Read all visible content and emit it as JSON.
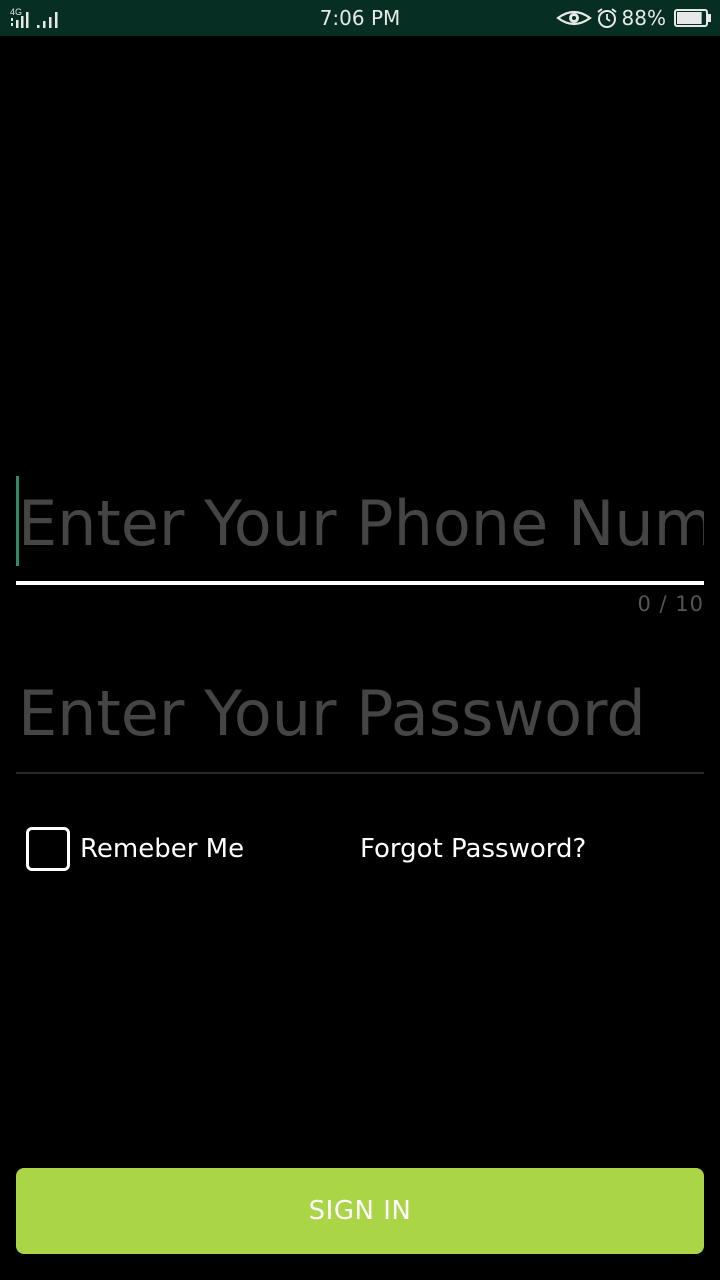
{
  "status_bar": {
    "network_type": "4G",
    "time": "7:06 PM",
    "battery_percent": "88%",
    "icons": [
      "signal-4g-icon",
      "signal-bars-icon",
      "eye-icon",
      "alarm-icon",
      "battery-icon"
    ],
    "battery_level": 0.88
  },
  "login": {
    "phone_placeholder": "Enter Your Phone Numb",
    "phone_counter": "0 / 10",
    "password_placeholder": "Enter Your Password",
    "remember_label": "Remeber Me",
    "remember_checked": false,
    "forgot_label": "Forgot Password?",
    "signin_label": "SIGN IN"
  },
  "colors": {
    "status_bar_bg": "#072e22",
    "background": "#000000",
    "accent_cursor": "#2e8b70",
    "signin_button": "#a9d546",
    "placeholder_text": "#454545"
  }
}
